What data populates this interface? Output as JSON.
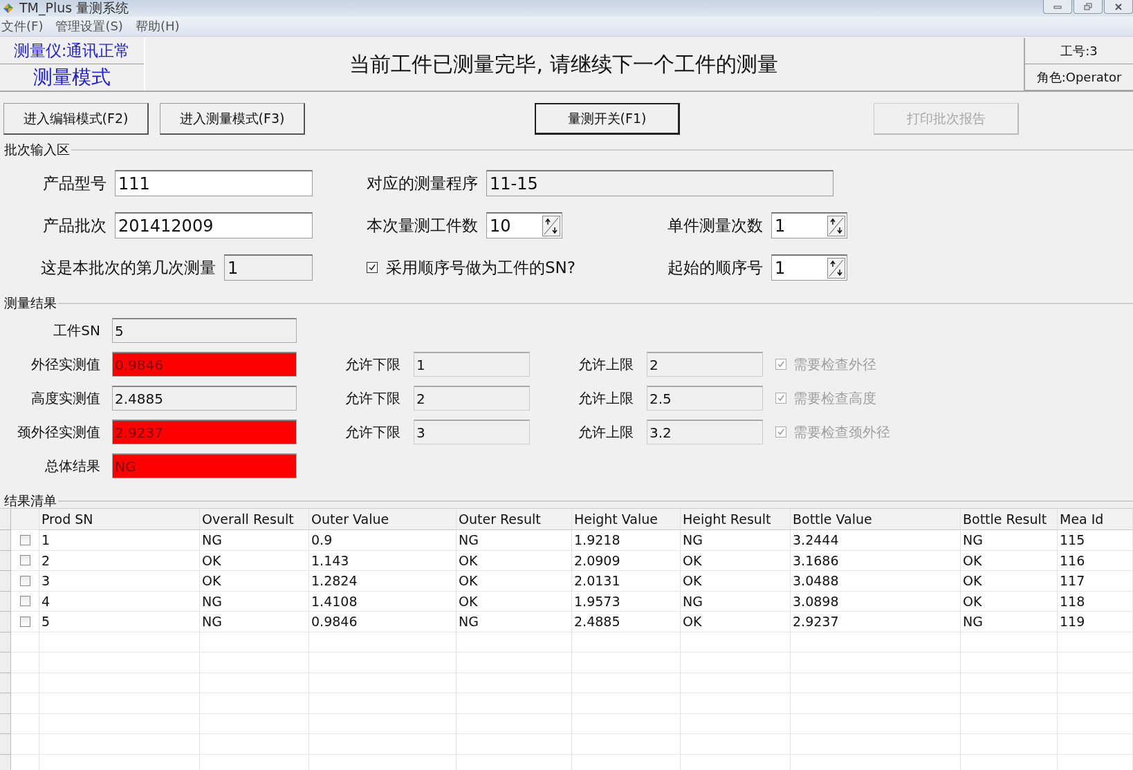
{
  "window": {
    "title": "TM_Plus 量测系统"
  },
  "menu": [
    "文件(F)",
    "管理设置(S)",
    "帮助(H)"
  ],
  "status": {
    "device": "测量仪:通讯正常",
    "mode": "测量模式",
    "message": "当前工件已测量完毕, 请继续下一个工件的测量",
    "operator_no": "工号:3",
    "role": "角色:Operator"
  },
  "toolbar": [
    {
      "label": "进入编辑模式(F2)",
      "disabled": false,
      "default": false
    },
    {
      "label": "进入测量模式(F3)",
      "disabled": false,
      "default": false
    },
    {
      "label": "量测开关(F1)",
      "disabled": false,
      "default": true
    },
    {
      "label": "打印批次报告",
      "disabled": true,
      "default": false
    }
  ],
  "batch": {
    "title": "批次输入区",
    "rows": [
      [
        {
          "kind": "field",
          "label": "产品型号",
          "value": "111",
          "readonly": false
        },
        {
          "kind": "long-field",
          "label": "对应的测量程序",
          "value": "11-15",
          "readonly": true
        }
      ],
      [
        {
          "kind": "field",
          "label": "产品批次",
          "value": "201412009",
          "readonly": false
        },
        {
          "kind": "spin",
          "label": "本次量测工件数",
          "value": "10"
        },
        {
          "kind": "spin",
          "label": "单件测量次数",
          "value": "1"
        }
      ],
      [
        {
          "kind": "short-field",
          "label": "这是本批次的第几次测量",
          "value": "1",
          "readonly": true
        },
        {
          "kind": "check",
          "label": "采用顺序号做为工件的SN?",
          "checked": true
        },
        {
          "kind": "spin",
          "label": "起始的顺序号",
          "value": "1"
        }
      ]
    ]
  },
  "results": {
    "title": "测量结果",
    "sn": {
      "label": "工件SN",
      "value": "5"
    },
    "rows": [
      {
        "label": "外径实测值",
        "value": "0.9846",
        "alarm": true,
        "lower_label": "允许下限",
        "lower": "1",
        "upper_label": "允许上限",
        "upper": "2",
        "check": "需要检查外径",
        "checked": true
      },
      {
        "label": "高度实测值",
        "value": "2.4885",
        "alarm": false,
        "lower_label": "允许下限",
        "lower": "2",
        "upper_label": "允许上限",
        "upper": "2.5",
        "check": "需要检查高度",
        "checked": true
      },
      {
        "label": "颈外径实测值",
        "value": "2.9237",
        "alarm": true,
        "lower_label": "允许下限",
        "lower": "3",
        "upper_label": "允许上限",
        "upper": "3.2",
        "check": "需要检查颈外径",
        "checked": true
      }
    ],
    "overall": {
      "label": "总体结果",
      "value": "NG",
      "alarm": true
    }
  },
  "list": {
    "title": "结果清单",
    "columns": [
      "Prod SN",
      "Overall Result",
      "Outer Value",
      "Outer Result",
      "Height Value",
      "Height Result",
      "Bottle Value",
      "Bottle Result",
      "Mea Id"
    ],
    "rows": [
      {
        "checked": false,
        "cells": [
          "1",
          "NG",
          "0.9",
          "NG",
          "1.9218",
          "NG",
          "3.2444",
          "NG",
          "115"
        ]
      },
      {
        "checked": false,
        "cells": [
          "2",
          "OK",
          "1.143",
          "OK",
          "2.0909",
          "OK",
          "3.1686",
          "OK",
          "116"
        ]
      },
      {
        "checked": false,
        "cells": [
          "3",
          "OK",
          "1.2824",
          "OK",
          "2.0131",
          "OK",
          "3.0488",
          "OK",
          "117"
        ]
      },
      {
        "checked": false,
        "cells": [
          "4",
          "NG",
          "1.4108",
          "OK",
          "1.9573",
          "NG",
          "3.0898",
          "OK",
          "118"
        ]
      },
      {
        "checked": false,
        "cells": [
          "5",
          "NG",
          "0.9846",
          "NG",
          "2.4885",
          "OK",
          "2.9237",
          "NG",
          "119"
        ]
      }
    ]
  }
}
